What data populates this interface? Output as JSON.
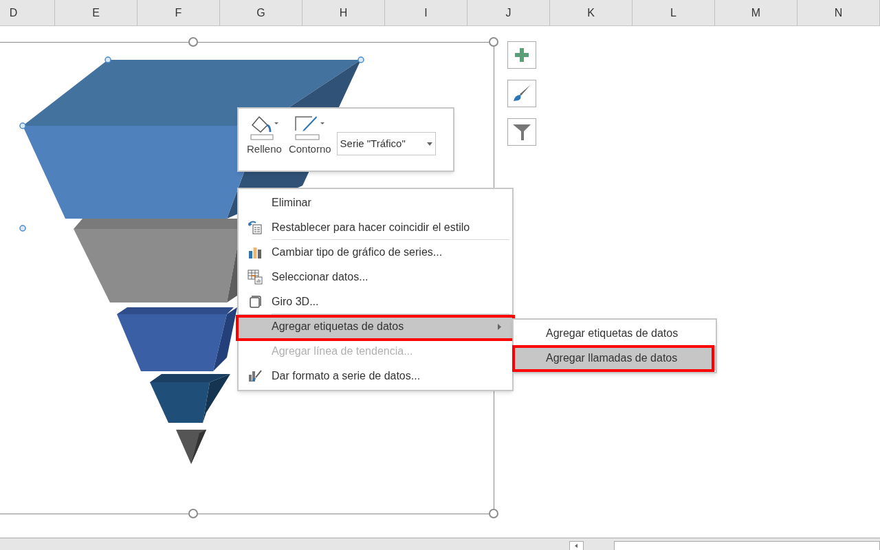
{
  "columns": [
    "D",
    "E",
    "F",
    "G",
    "H",
    "I",
    "J",
    "K",
    "L",
    "M",
    "N"
  ],
  "mini_toolbar": {
    "buttons": [
      {
        "label": "Relleno"
      },
      {
        "label": "Contorno"
      }
    ],
    "series_select": {
      "value": "Serie \"Tráfico\""
    }
  },
  "context_menu": {
    "items": [
      {
        "label": "Eliminar",
        "disabled": false,
        "selected": false,
        "submenu": false,
        "annotated": false,
        "separator_after": false
      },
      {
        "label": "Restablecer para hacer coincidir el estilo",
        "disabled": false,
        "selected": false,
        "submenu": false,
        "annotated": false,
        "separator_after": true
      },
      {
        "label": "Cambiar tipo de gráfico de series...",
        "disabled": false,
        "selected": false,
        "submenu": false,
        "annotated": false,
        "separator_after": false
      },
      {
        "label": "Seleccionar datos...",
        "disabled": false,
        "selected": false,
        "submenu": false,
        "annotated": false,
        "separator_after": false
      },
      {
        "label": "Giro 3D...",
        "disabled": false,
        "selected": false,
        "submenu": false,
        "annotated": false,
        "separator_after": true
      },
      {
        "label": "Agregar etiquetas de datos",
        "disabled": false,
        "selected": true,
        "submenu": true,
        "annotated": true,
        "separator_after": false
      },
      {
        "label": "Agregar línea de tendencia...",
        "disabled": true,
        "selected": false,
        "submenu": false,
        "annotated": false,
        "separator_after": false
      },
      {
        "label": "Dar formato a serie de datos...",
        "disabled": false,
        "selected": false,
        "submenu": false,
        "annotated": false,
        "separator_after": false
      }
    ]
  },
  "submenu": {
    "items": [
      {
        "label": "Agregar etiquetas de datos",
        "selected": false,
        "annotated": false
      },
      {
        "label": "Agregar llamadas de datos",
        "selected": true,
        "annotated": true
      }
    ]
  }
}
